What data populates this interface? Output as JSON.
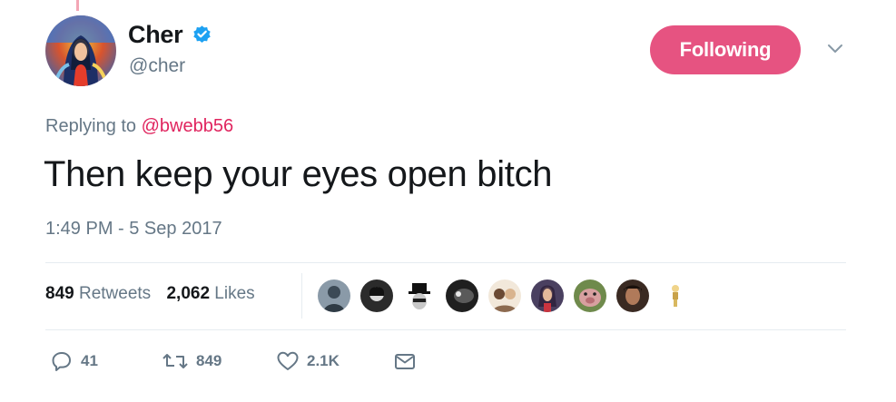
{
  "colors": {
    "text_primary": "#14171a",
    "text_secondary": "#657786",
    "accent_pink": "#e0245e",
    "verified_blue": "#1da1f2",
    "divider": "#e6ecf0"
  },
  "author": {
    "display_name": "Cher",
    "handle": "@cher",
    "verified": true,
    "avatar_icon": "profile-avatar"
  },
  "follow_button": {
    "label": "Following"
  },
  "menu_icon": "chevron-down-icon",
  "reply": {
    "prefix": "Replying to",
    "handle": "@bwebb56"
  },
  "tweet": {
    "text": "Then keep your eyes open bitch",
    "timestamp": "1:49 PM - 5 Sep 2017"
  },
  "stats": {
    "retweets_count": "849",
    "retweets_label": "Retweets",
    "likes_count": "2,062",
    "likes_label": "Likes",
    "liker_avatars": [
      {
        "name": "liker-avatar-1",
        "bg": "#6b7d8c"
      },
      {
        "name": "liker-avatar-2",
        "bg": "#2b2b2b"
      },
      {
        "name": "liker-avatar-3",
        "bg": "#ffffff"
      },
      {
        "name": "liker-avatar-4",
        "bg": "#1f1f1f"
      },
      {
        "name": "liker-avatar-5",
        "bg": "#e8d9c4"
      },
      {
        "name": "liker-avatar-6",
        "bg": "#5a4a6a"
      },
      {
        "name": "liker-avatar-7",
        "bg": "#6f8a4c"
      },
      {
        "name": "liker-avatar-8",
        "bg": "#3a2a22"
      },
      {
        "name": "liker-avatar-9",
        "bg": "#ffffff"
      }
    ]
  },
  "actions": {
    "reply_count": "41",
    "retweet_count": "849",
    "like_count": "2.1K"
  }
}
